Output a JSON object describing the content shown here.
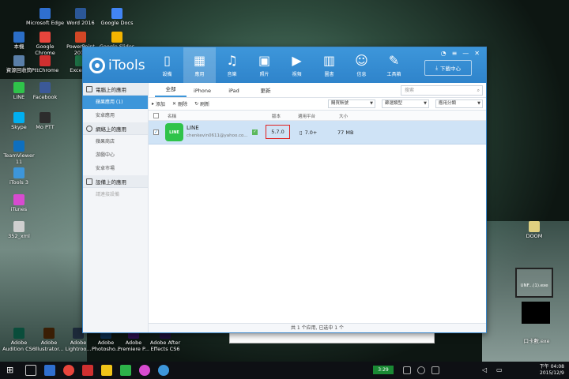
{
  "desktop": {
    "icons_top": [
      {
        "label": "Microsoft Edge",
        "color": "#2f6fcf"
      },
      {
        "label": "Word 2016",
        "color": "#2b5797"
      },
      {
        "label": "Google Docs",
        "color": "#4285f4"
      }
    ],
    "icons_row2": [
      {
        "label": "本機",
        "color": "#2b6ec7"
      },
      {
        "label": "Google Chrome",
        "color": "#e8453c"
      },
      {
        "label": "PowerPoint 2016",
        "color": "#d24726"
      },
      {
        "label": "Google Slides",
        "color": "#f4b400"
      }
    ],
    "icons_row3": [
      {
        "label": "資源回收筒",
        "color": "#5a7fa8"
      },
      {
        "label": "PttChrome",
        "color": "#d03030"
      },
      {
        "label": "Excel 20",
        "color": "#1e7145"
      }
    ],
    "icons_row4": [
      {
        "label": "LINE",
        "color": "#2fc34a"
      },
      {
        "label": "Facebook",
        "color": "#3b5998"
      }
    ],
    "icons_row5": [
      {
        "label": "Skype",
        "color": "#00aff0"
      },
      {
        "label": "Mo PTT",
        "color": "#2c2c2c"
      }
    ],
    "icons_col": [
      {
        "label": "TeamViewer 11",
        "color": "#0e6fbf"
      },
      {
        "label": "iTools 3",
        "color": "#3d96da"
      },
      {
        "label": "iTunes",
        "color": "#d84bd0"
      },
      {
        "label": "352_xml",
        "color": "#cfcfcf"
      }
    ],
    "icons_bottom": [
      {
        "label": "Adobe Audition CS6",
        "color": "#0a4d3b"
      },
      {
        "label": "Adobe Illustrator...",
        "color": "#3a1e05"
      },
      {
        "label": "Adobe Lightroo...",
        "color": "#1d2a3a"
      },
      {
        "label": "Adobe Photosho...",
        "color": "#0c2d4d"
      },
      {
        "label": "Adobe Premiere P...",
        "color": "#2a0f4d"
      },
      {
        "label": "Adobe After Effects CS6",
        "color": "#1e0f3a"
      }
    ],
    "right_icons": {
      "doom_label": "DOOM",
      "selected_file": "UNF...(1).exe",
      "bottom_file": "口卡數.exe"
    }
  },
  "window": {
    "app_title": "iTools",
    "nav": [
      {
        "label": "設備",
        "icon": "device-icon",
        "glyph": "▯"
      },
      {
        "label": "應用",
        "icon": "apps-icon",
        "glyph": "▦"
      },
      {
        "label": "音樂",
        "icon": "music-icon",
        "glyph": "♫"
      },
      {
        "label": "照片",
        "icon": "photo-icon",
        "glyph": "▣"
      },
      {
        "label": "視頻",
        "icon": "video-icon",
        "glyph": "▶"
      },
      {
        "label": "圖書",
        "icon": "book-icon",
        "glyph": "▥"
      },
      {
        "label": "信息",
        "icon": "info-icon",
        "glyph": "☺"
      },
      {
        "label": "工具箱",
        "icon": "toolbox-icon",
        "glyph": "✎"
      }
    ],
    "download_label": "下載中心",
    "sidebar": {
      "sec1": "電腦上的應用",
      "sec1_items": [
        "蘋果應用 (1)",
        "安卓應用"
      ],
      "sec2": "網絡上的應用",
      "sec2_items": [
        "蘋果商店",
        "游戲中心",
        "安卓市場"
      ],
      "sec3": "設備上的應用",
      "sec3_items": [
        "請連接設備"
      ]
    },
    "tabs": [
      "全部",
      "iPhone",
      "iPad",
      "更新"
    ],
    "search_placeholder": "搜索",
    "toolbar": {
      "add": "添加",
      "delete": "刪除",
      "refresh": "刷新"
    },
    "selects": [
      "購買賬號",
      "篩選類型",
      "應用分類"
    ],
    "columns": {
      "name": "名稱",
      "version": "版本",
      "platform": "適用平台",
      "size": "大小"
    },
    "row": {
      "icon_text": "LINE",
      "name": "LINE",
      "developer": "chenkevin0611@yahoo.co...",
      "version": "5.7.0",
      "platform": "7.0+",
      "size": "77 MB"
    },
    "status": "共 1 个应用, 已选中 1 个"
  },
  "taskbar": {
    "tray_time_badge": "3:29",
    "clock_time": "下午 04:08",
    "clock_date": "2015/12/9"
  }
}
